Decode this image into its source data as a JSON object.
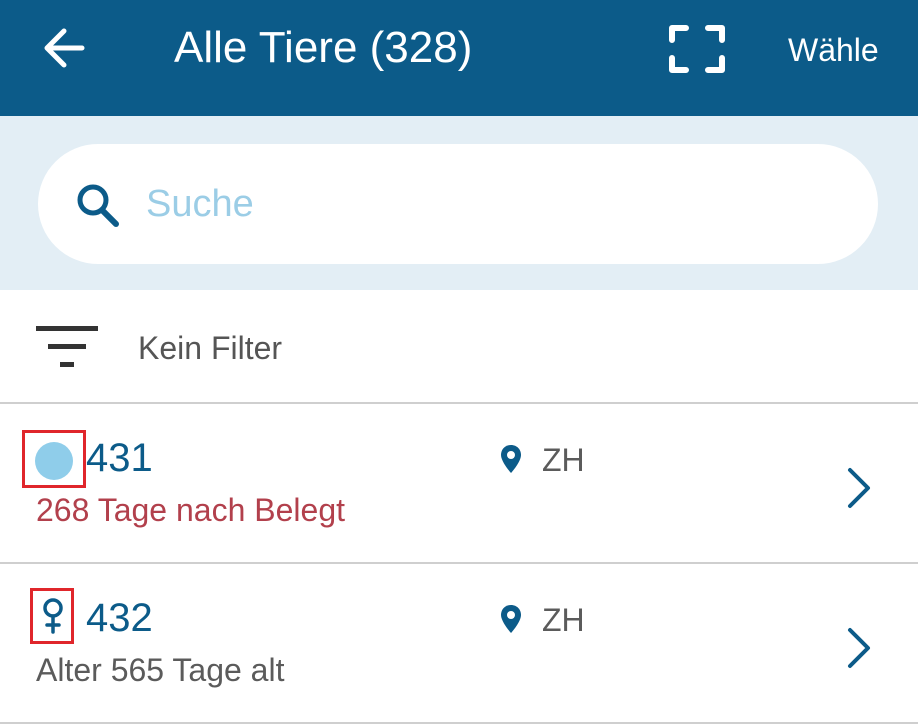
{
  "header": {
    "title": "Alle Tiere (328)",
    "select_label": "Wähle",
    "back_icon": "arrow-left-icon",
    "scan_icon": "scan-frame-icon",
    "background_color": "#0c5b89"
  },
  "search": {
    "placeholder": "Suche",
    "value": "",
    "icon": "search-icon"
  },
  "filter": {
    "label": "Kein Filter",
    "icon": "filter-icon"
  },
  "animals": [
    {
      "id": "431",
      "status": "268 Tage nach Belegt",
      "status_color": "#b2404c",
      "location": "ZH",
      "marker": "light-blue-dot-icon"
    },
    {
      "id": "432",
      "status": "Alter 565 Tage alt",
      "status_color": "#5b5b5b",
      "location": "ZH",
      "marker": "female-icon"
    }
  ]
}
